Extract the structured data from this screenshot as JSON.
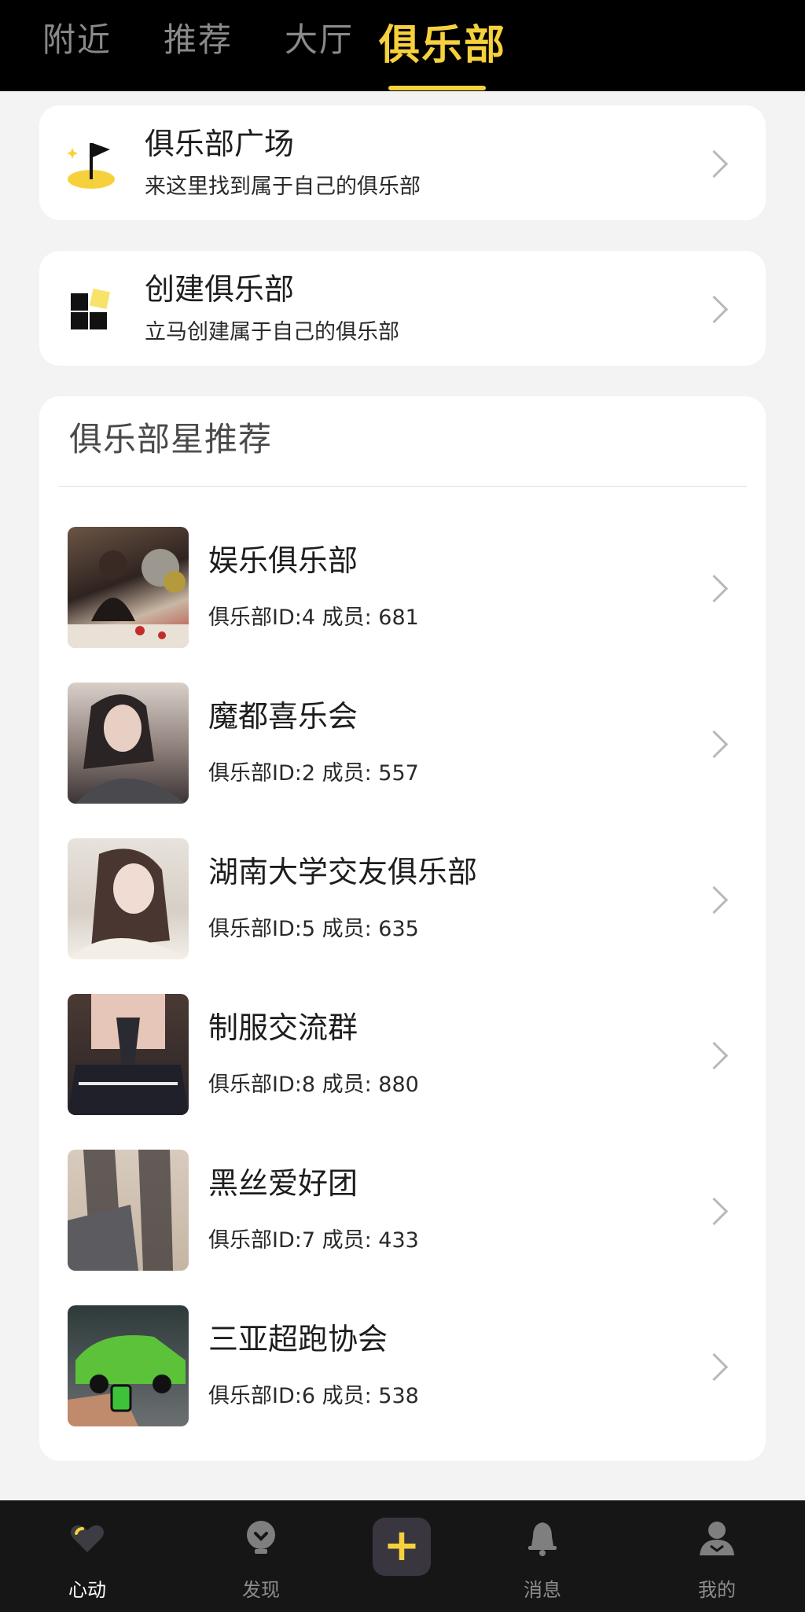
{
  "top_tabs": [
    "附近",
    "推荐",
    "大厅",
    "俱乐部"
  ],
  "entries": [
    {
      "title": "俱乐部广场",
      "subtitle": "来这里找到属于自己的俱乐部",
      "icon": "flag-icon"
    },
    {
      "title": "创建俱乐部",
      "subtitle": "立马创建属于自己的俱乐部",
      "icon": "blocks-icon"
    }
  ],
  "recommend": {
    "title": "俱乐部星推荐",
    "clubs": [
      {
        "name": "娱乐俱乐部",
        "meta": "俱乐部ID:4 成员: 681",
        "thumb": "party-photo"
      },
      {
        "name": "魔都喜乐会",
        "meta": "俱乐部ID:2 成员: 557",
        "thumb": "portrait-photo"
      },
      {
        "name": "湖南大学交友俱乐部",
        "meta": "俱乐部ID:5 成员: 635",
        "thumb": "selfie-photo"
      },
      {
        "name": "制服交流群",
        "meta": "俱乐部ID:8 成员: 880",
        "thumb": "uniform-photo"
      },
      {
        "name": "黑丝爱好团",
        "meta": "俱乐部ID:7 成员: 433",
        "thumb": "stockings-photo"
      },
      {
        "name": "三亚超跑协会",
        "meta": "俱乐部ID:6 成员: 538",
        "thumb": "sportscar-photo"
      }
    ]
  },
  "bottom_nav": [
    {
      "label": "心动",
      "icon": "heart-icon",
      "active": true
    },
    {
      "label": "发现",
      "icon": "discover-bulb-icon",
      "active": false
    },
    {
      "label": "",
      "icon": "plus-icon",
      "active": false
    },
    {
      "label": "消息",
      "icon": "bell-icon",
      "active": false
    },
    {
      "label": "我的",
      "icon": "user-icon",
      "active": false
    }
  ],
  "plus_symbol": "+",
  "colors": {
    "accent": "#f7d13b",
    "topbar": "#000000",
    "bottombar": "#161616",
    "background": "#f3f3f3"
  }
}
